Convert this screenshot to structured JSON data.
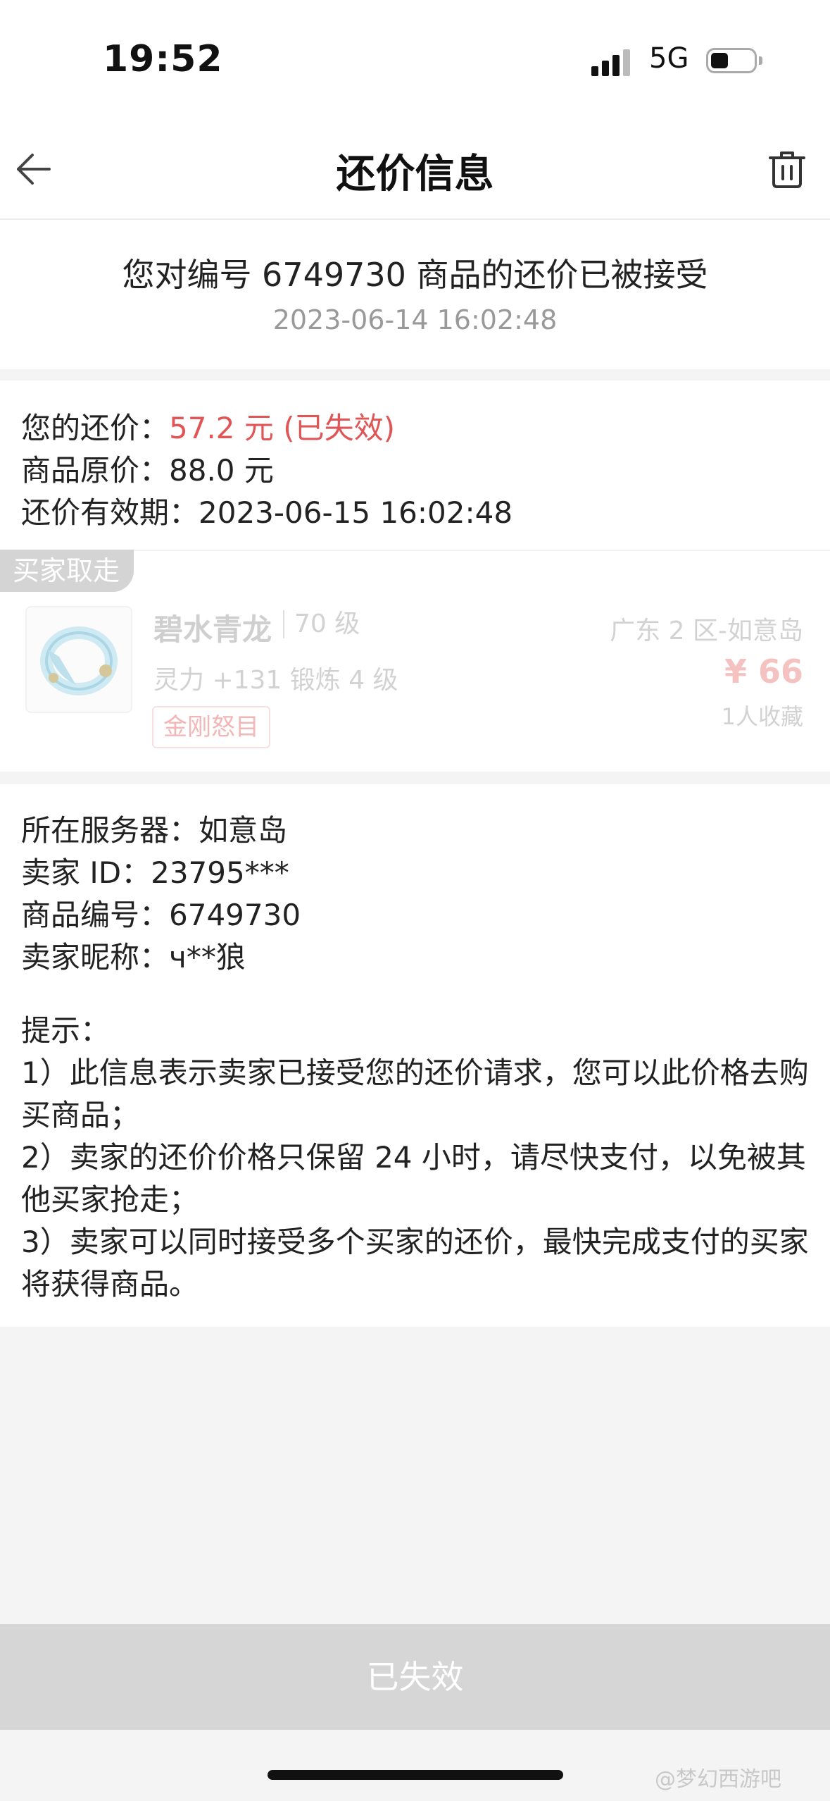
{
  "status_bar": {
    "time": "19:52",
    "network": "5G",
    "battery_level": 0.3
  },
  "nav": {
    "title": "还价信息",
    "back_icon": "arrow-left-icon",
    "trash_icon": "trash-icon"
  },
  "header": {
    "message": "您对编号 6749730 商品的还价已被接受",
    "timestamp": "2023-06-14 16:02:48"
  },
  "offer": {
    "your_offer_label": "您的还价：",
    "your_offer_value": "57.2 元 (已失效)",
    "original_price_label": "商品原价：",
    "original_price_value": "88.0 元",
    "valid_until_label": "还价有效期：",
    "valid_until_value": "2023-06-15 16:02:48"
  },
  "product_card": {
    "tag": "买家取走",
    "name": "碧水青龙",
    "level": "70 级",
    "server": "广东 2 区-如意岛",
    "attributes": "灵力 +131 锻炼 4 级",
    "price": "¥ 66",
    "favorites": "1人收藏",
    "skill_tag": "金刚怒目"
  },
  "details": {
    "server_label": "所在服务器：",
    "server_value": "如意岛",
    "seller_id_label": "卖家 ID：",
    "seller_id_value": "23795***",
    "product_id_label": "商品编号：",
    "product_id_value": "6749730",
    "seller_nick_label": "卖家昵称：",
    "seller_nick_value": "ч**狼"
  },
  "tips": {
    "title": "提示：",
    "items": [
      "1）此信息表示卖家已接受您的还价请求，您可以此价格去购买商品；",
      "2）卖家的还价价格只保留 24 小时，请尽快支付，以免被其他买家抢走；",
      "3）卖家可以同时接受多个买家的还价，最快完成支付的买家将获得商品。"
    ]
  },
  "bottom": {
    "button_label": "已失效"
  },
  "watermark": "@梦幻西游吧",
  "colors": {
    "accent_red": "#e05555",
    "disabled_gray": "#d6d6d6"
  }
}
